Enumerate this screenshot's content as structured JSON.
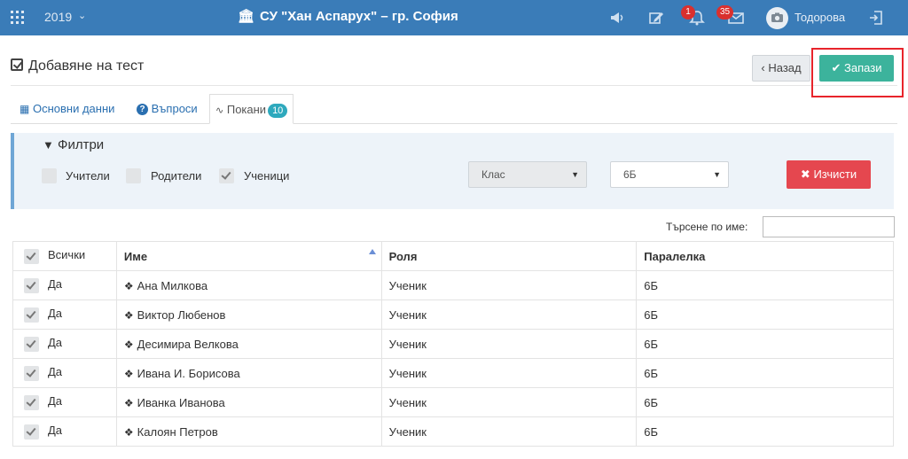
{
  "header": {
    "year": "2019",
    "school": "СУ \"Хан Аспарух\" – гр. София",
    "notifications_count": "1",
    "messages_count": "35",
    "username": "Тодорова",
    "icons": [
      "grid-icon",
      "bank-icon",
      "megaphone-icon",
      "edit-icon",
      "bell-icon",
      "envelope-icon",
      "avatar",
      "logout-icon"
    ]
  },
  "page": {
    "title": "Добавяне на тест",
    "back_label": "Назад",
    "save_label": "Запази"
  },
  "tabs": [
    {
      "label": "Основни данни",
      "icon": "grid-icon"
    },
    {
      "label": "Въпроси",
      "icon": "question-circle-icon"
    },
    {
      "label": "Покани",
      "icon": "rss-icon",
      "count": "10"
    }
  ],
  "filters": {
    "title": "Филтри",
    "checkboxes": [
      {
        "label": "Учители",
        "checked": false
      },
      {
        "label": "Родители",
        "checked": false
      },
      {
        "label": "Ученици",
        "checked": true
      }
    ],
    "class_select": "Клас",
    "division_select": "6Б",
    "clear_label": "Изчисти"
  },
  "search": {
    "label": "Търсене по име:",
    "value": ""
  },
  "table": {
    "headers": [
      "Всички",
      "Име",
      "Роля",
      "Паралелка"
    ],
    "rows": [
      {
        "selected": "Да",
        "name": "Ана Милкова",
        "role": "Ученик",
        "division": "6Б"
      },
      {
        "selected": "Да",
        "name": "Виктор Любенов",
        "role": "Ученик",
        "division": "6Б"
      },
      {
        "selected": "Да",
        "name": "Десимира Велкова",
        "role": "Ученик",
        "division": "6Б"
      },
      {
        "selected": "Да",
        "name": "Ивана И. Борисова",
        "role": "Ученик",
        "division": "6Б"
      },
      {
        "selected": "Да",
        "name": "Иванка Иванова",
        "role": "Ученик",
        "division": "6Б"
      },
      {
        "selected": "Да",
        "name": "Калоян Петров",
        "role": "Ученик",
        "division": "6Б"
      }
    ]
  },
  "colors": {
    "topbar": "#3a7cb8",
    "save": "#3cb39c",
    "clear": "#e5474f",
    "highlight": "#e8242b",
    "badge": "#d9302e"
  }
}
